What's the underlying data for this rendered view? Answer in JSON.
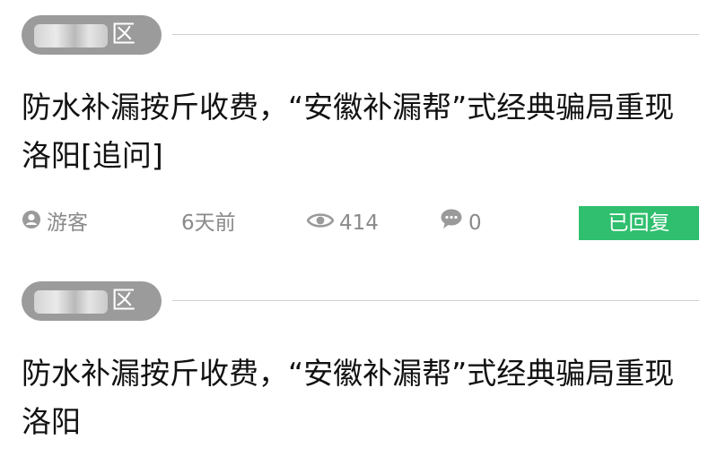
{
  "posts": [
    {
      "tag": "区",
      "title": "防水补漏按斤收费，“安徽补漏帮”式经典骗局重现洛阳[追问]",
      "author": "游客",
      "time": "6天前",
      "views": "414",
      "comments": "0",
      "status": "已回复"
    },
    {
      "tag": "区",
      "title": "防水补漏按斤收费，“安徽补漏帮”式经典骗局重现洛阳"
    }
  ],
  "icons": {
    "author": "user-icon",
    "views": "eye-icon",
    "comments": "chat-bubble-icon"
  },
  "colors": {
    "tag_pill": "#9b9b9b",
    "status_badge": "#2fbf6e",
    "meta_text": "#8a8a8a"
  }
}
